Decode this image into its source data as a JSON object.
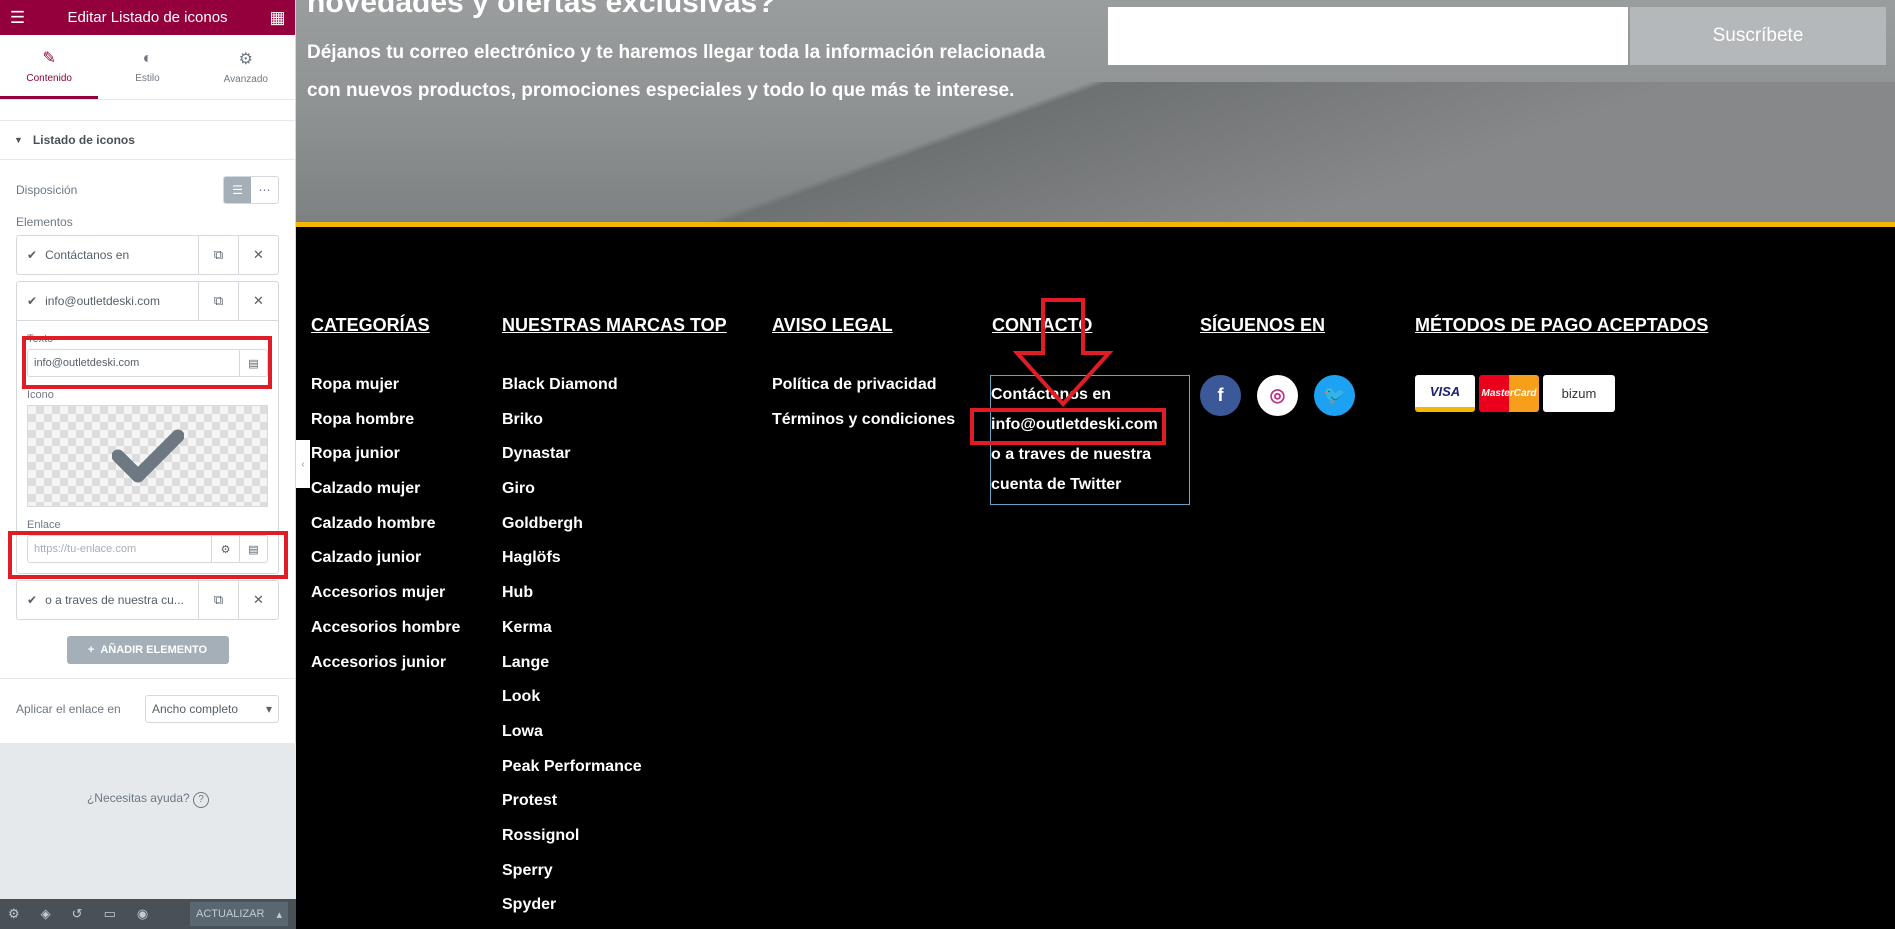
{
  "editor": {
    "title": "Editar Listado de iconos",
    "tabs": [
      {
        "label": "Contenido",
        "icon": "pencil-icon"
      },
      {
        "label": "Estilo",
        "icon": "contrast-icon"
      },
      {
        "label": "Avanzado",
        "icon": "gear-icon"
      }
    ],
    "section": "Listado de iconos",
    "layout_label": "Disposición",
    "elements_label": "Elementos",
    "items": [
      {
        "text": "Contáctanos en"
      },
      {
        "text": "info@outletdeski.com"
      },
      {
        "text": "o a traves de nuestra cu..."
      }
    ],
    "text_label": "Texto",
    "text_value": "info@outletdeski.com",
    "icon_label": "Icono",
    "link_label": "Enlace",
    "link_placeholder": "https://tu-enlace.com",
    "add_button": "AÑADIR ELEMENTO",
    "apply_label": "Aplicar el enlace en",
    "apply_value": "Ancho completo",
    "help": "¿Necesitas ayuda?",
    "update": "ACTUALIZAR"
  },
  "site": {
    "hero_title": "novedades y ofertas exclusivas?",
    "hero_text": "Déjanos tu correo electrónico y te haremos llegar toda la información relacionada con nuevos productos, promociones especiales y todo lo que más te interese.",
    "subscribe": "Suscríbete",
    "columns": {
      "categorias": {
        "title": "CATEGORÍAS",
        "items": [
          "Ropa mujer",
          "Ropa hombre",
          "Ropa junior",
          "Calzado mujer",
          "Calzado hombre",
          "Calzado junior",
          "Accesorios mujer",
          "Accesorios hombre",
          "Accesorios junior"
        ]
      },
      "marcas": {
        "title": "NUESTRAS MARCAS TOP",
        "items": [
          "Black Diamond",
          "Briko",
          "Dynastar",
          "Giro",
          "Goldbergh",
          "Haglöfs",
          "Hub",
          "Kerma",
          "Lange",
          "Look",
          "Lowa",
          "Peak Performance",
          "Protest",
          "Rossignol",
          "Sperry",
          "Spyder"
        ]
      },
      "legal": {
        "title": "AVISO LEGAL",
        "items": [
          "Política de privacidad",
          "Términos y condiciones"
        ]
      },
      "contacto": {
        "title": "CONTACTO",
        "items": [
          "Contáctanos en",
          "info@outletdeski.com",
          "o a traves de nuestra",
          "cuenta de Twitter"
        ]
      },
      "siguenos": {
        "title": "SÍGUENOS EN"
      },
      "pagos": {
        "title": "MÉTODOS DE PAGO ACEPTADOS",
        "cards": [
          "VISA",
          "MasterCard",
          "bizum"
        ]
      }
    }
  },
  "colors": {
    "accent": "#93003c",
    "highlight": "#e01d25",
    "facebook": "#3b5998",
    "instagram": "#c13584",
    "twitter": "#1da1f2",
    "yellow": "#f2b705"
  }
}
